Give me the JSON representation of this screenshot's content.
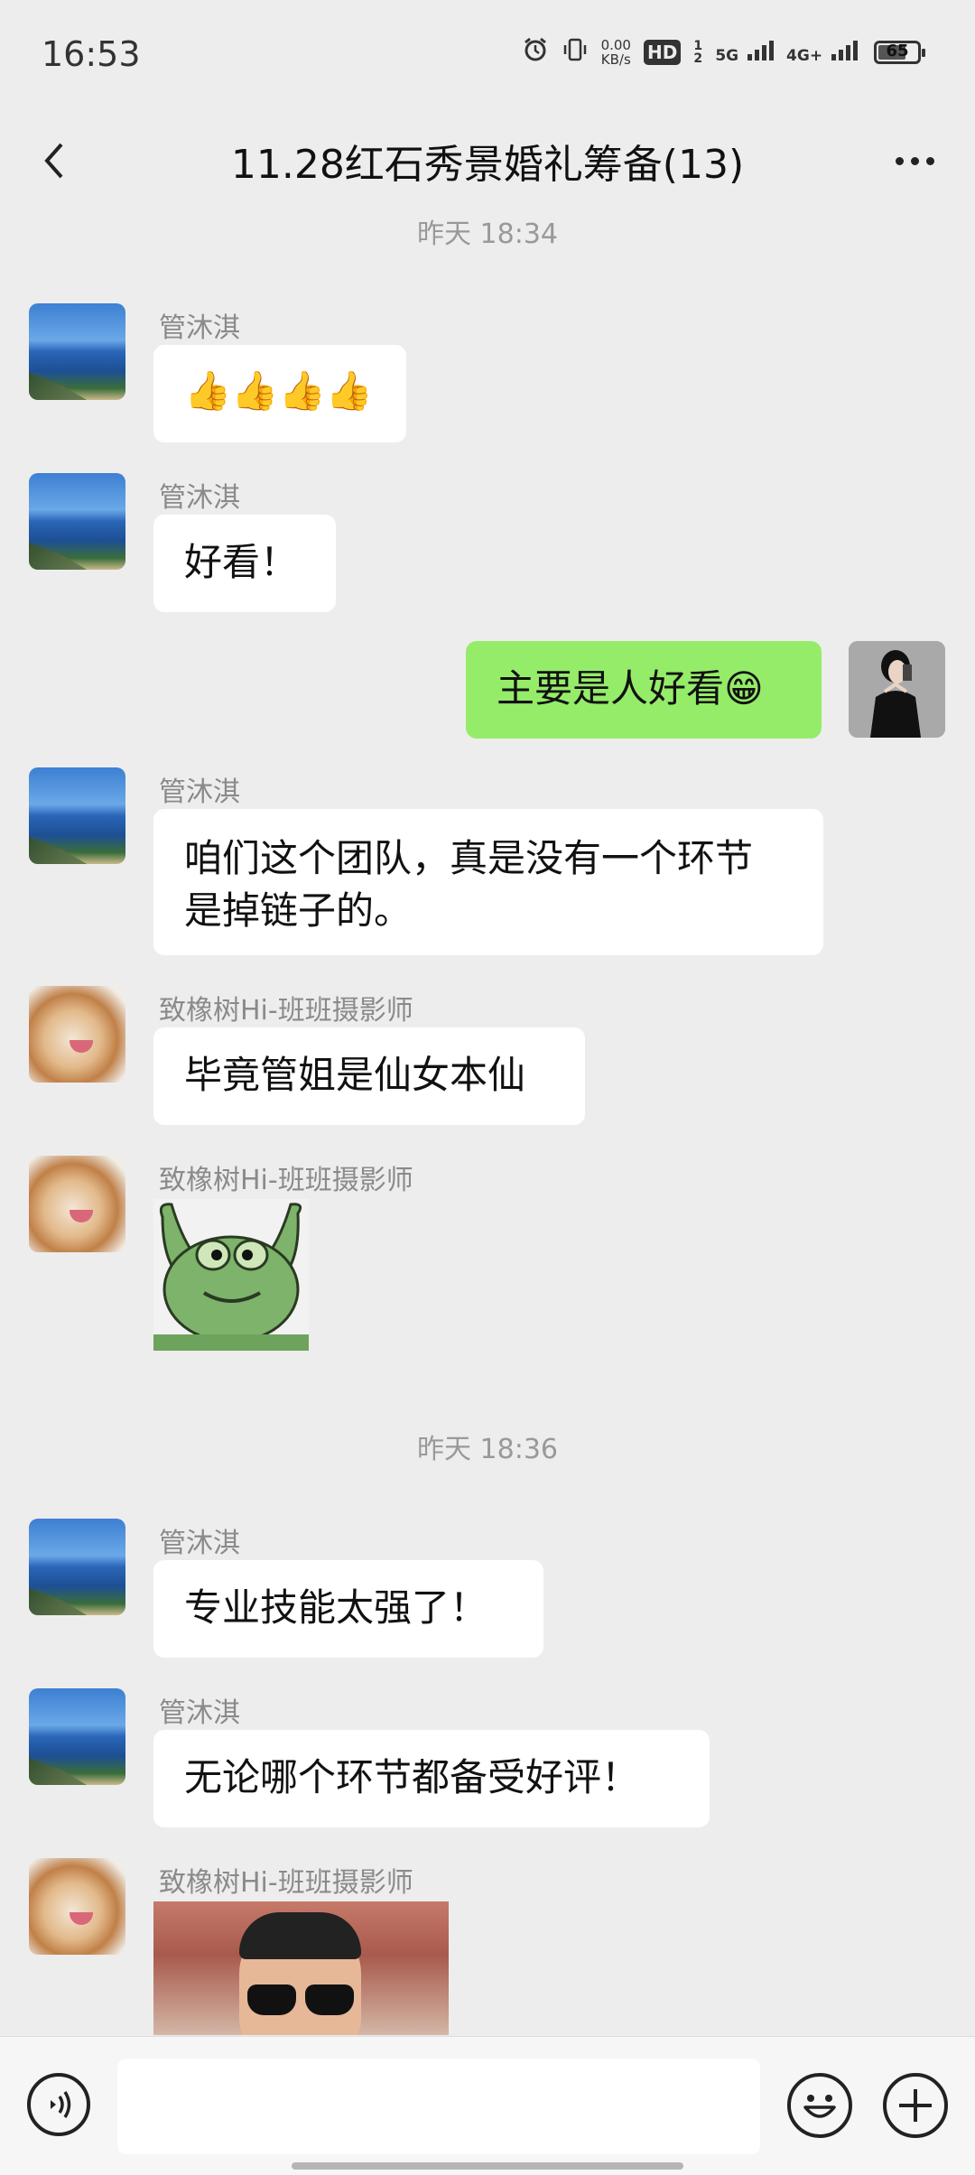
{
  "status_bar": {
    "time": "16:53",
    "net_speed_value": "0.00",
    "net_speed_unit": "KB/s",
    "hd_label": "HD",
    "hd_sub": "1 2",
    "signal_5g": "5G",
    "signal_4g": "4G+",
    "battery_level": "65",
    "icons": [
      "alarm-icon",
      "vibrate-icon",
      "signal-bars-icon",
      "battery-icon"
    ]
  },
  "header": {
    "title": "11.28红石秀景婚礼筹备(13)",
    "back_icon": "chevron-left-icon",
    "more_icon": "more-dots-icon"
  },
  "timestamps": [
    "昨天 18:34",
    "昨天 18:36"
  ],
  "messages": [
    {
      "sender": "管沐淇",
      "type": "emoji",
      "text": "👍👍👍👍",
      "avatar": "landscape-avatar"
    },
    {
      "sender": "管沐淇",
      "type": "text",
      "text": "好看！",
      "avatar": "landscape-avatar"
    },
    {
      "sender": "me",
      "type": "text",
      "text": "主要是人好看😁",
      "avatar": "selfie-avatar"
    },
    {
      "sender": "管沐淇",
      "type": "text",
      "text_line1": "咱们这个团队，真是没有一个环节",
      "text_line2": "是掉链子的。",
      "avatar": "landscape-avatar"
    },
    {
      "sender": "致橡树Hi-班班摄影师",
      "type": "text",
      "text": "毕竟管姐是仙女本仙",
      "avatar": "dog-avatar"
    },
    {
      "sender": "致橡树Hi-班班摄影师",
      "type": "sticker",
      "sticker": "frog-sticker",
      "avatar": "dog-avatar"
    },
    {
      "sender": "管沐淇",
      "type": "text",
      "text": "专业技能太强了！",
      "avatar": "landscape-avatar"
    },
    {
      "sender": "管沐淇",
      "type": "text",
      "text": "无论哪个环节都备受好评！",
      "avatar": "landscape-avatar"
    },
    {
      "sender": "致橡树Hi-班班摄影师",
      "type": "sticker",
      "sticker": "sunglasses-photo-sticker",
      "avatar": "dog-avatar"
    }
  ],
  "input_bar": {
    "voice_icon": "voice-icon",
    "input_value": "",
    "emoji_icon": "emoji-icon",
    "plus_icon": "plus-icon"
  },
  "colors": {
    "background": "#ededed",
    "self_bubble": "#95ec69",
    "other_bubble": "#ffffff",
    "timestamp_text": "#999999"
  }
}
